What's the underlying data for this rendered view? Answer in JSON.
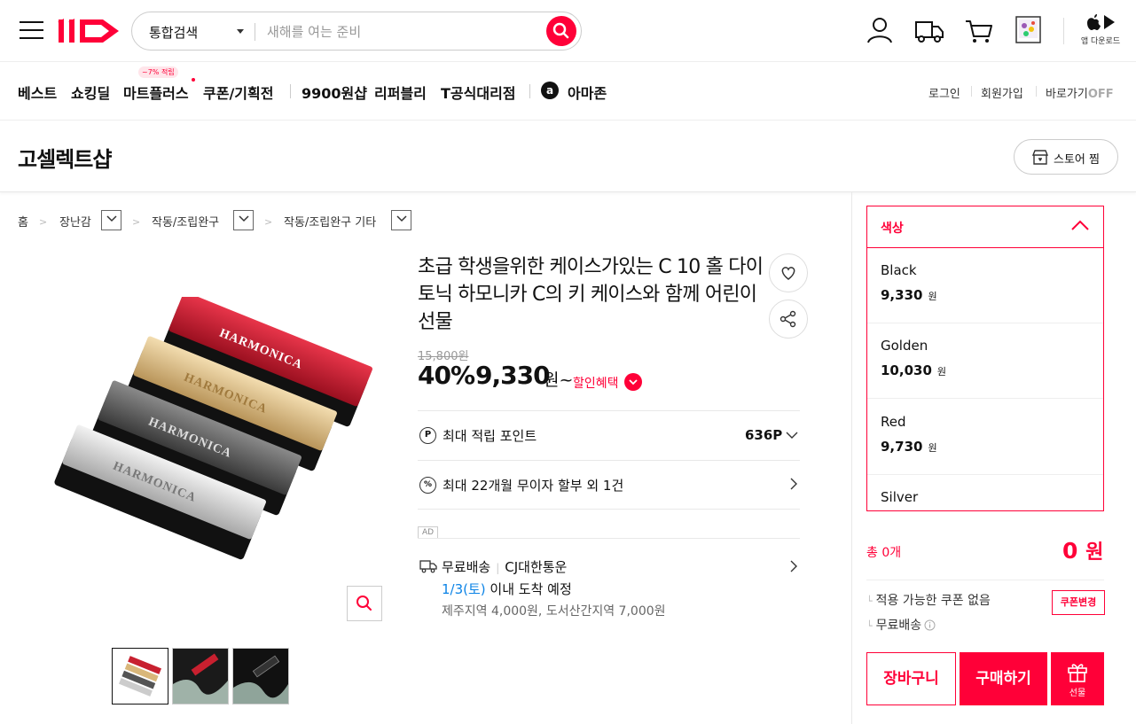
{
  "header": {
    "logo": "11",
    "search_category": "통합검색",
    "search_placeholder": "새해를 여는 준비",
    "app_download": "앱 다운로드"
  },
  "nav": {
    "items": [
      "베스트",
      "쇼킹딜",
      "마트플러스",
      "쿠폰/기획전",
      "9900원샵",
      "리퍼블리",
      "T공식대리점",
      "아마존"
    ],
    "promo_badge": "~7% 적립",
    "login": "로그인",
    "signup": "회원가입",
    "shortcut": "바로가기",
    "shortcut_state": "OFF"
  },
  "store": {
    "name": "고셀렉트샵",
    "follow_label": "스토어 찜"
  },
  "breadcrumb": [
    "홈",
    "장난감",
    "작동/조립완구",
    "작동/조립완구 기타"
  ],
  "product": {
    "title": "초급 학생을위한 케이스가있는 C 10 홀 다이토닉 하모니카 C의 키 케이스와 함께 어린이 선물",
    "original_price": "15,800원",
    "discount_rate": "40%",
    "sale_price": "9,330",
    "currency_suffix": "원~",
    "discount_benefit": "할인혜택",
    "points_label": "최대 적립 포인트",
    "points_value": "636P",
    "installment": "최대 22개월 무이자 할부 외 1건",
    "ad_tag": "AD",
    "shipping_free": "무료배송",
    "carrier": "CJ대한통운",
    "arrival_date": "1/3(토)",
    "arrival_text": " 이내 도착 예정",
    "extra_fee": "제주지역 4,000원, 도서산간지역 7,000원"
  },
  "options": {
    "label": "색상",
    "items": [
      {
        "name": "Black",
        "price": "9,330",
        "unit": "원"
      },
      {
        "name": "Golden",
        "price": "10,030",
        "unit": "원"
      },
      {
        "name": "Red",
        "price": "9,730",
        "unit": "원"
      },
      {
        "name": "Silver",
        "price": "",
        "unit": ""
      }
    ]
  },
  "summary": {
    "total_count": "총 0개",
    "total_amount": "0",
    "total_unit": "원",
    "coupon_text": "적용 가능한 쿠폰 없음",
    "coupon_button": "쿠폰변경",
    "free_ship": "무료배송",
    "cart_button": "장바구니",
    "buy_button": "구매하기",
    "gift_button": "선물"
  },
  "colors": {
    "brand": "#ff0038",
    "link_blue": "#0b83e6"
  }
}
